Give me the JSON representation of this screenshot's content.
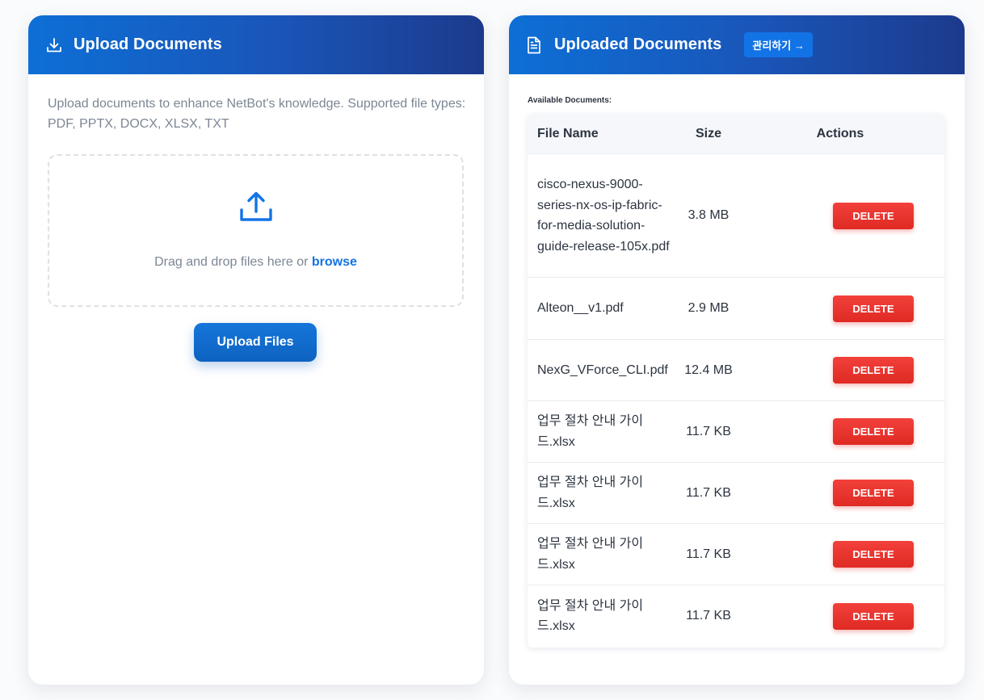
{
  "upload_panel": {
    "title": "Upload Documents",
    "icon": "download-icon",
    "description": "Upload documents to enhance NetBot's knowledge. Supported file types: PDF, PPTX, DOCX, XLSX, TXT",
    "dropzone_text": "Drag and drop files here or",
    "browse_label": "browse",
    "upload_button": "Upload Files"
  },
  "documents_panel": {
    "title": "Uploaded Documents",
    "icon": "document-icon",
    "manage_button": "관리하기 →",
    "available_label": "Available Documents:",
    "columns": {
      "name": "File Name",
      "size": "Size",
      "actions": "Actions"
    },
    "delete_label": "DELETE",
    "rows": [
      {
        "name": "cisco-nexus-9000-series-nx-os-ip-fabric-for-media-solution-guide-release-105x.pdf",
        "size": "3.8 MB"
      },
      {
        "name": "Alteon__v1.pdf",
        "size": "2.9 MB"
      },
      {
        "name": "NexG_VForce_CLI.pdf",
        "size": "12.4 MB"
      },
      {
        "name": "업무 절차 안내 가이드.xlsx",
        "size": "11.7 KB"
      },
      {
        "name": "업무 절차 안내 가이드.xlsx",
        "size": "11.7 KB"
      },
      {
        "name": "업무 절차 안내 가이드.xlsx",
        "size": "11.7 KB"
      },
      {
        "name": "업무 절차 안내 가이드.xlsx",
        "size": "11.7 KB"
      }
    ]
  },
  "colors": {
    "header_gradient_start": "#0d6fd6",
    "header_gradient_end": "#1c3a8c",
    "accent": "#1273e6",
    "delete": "#e8322c"
  }
}
